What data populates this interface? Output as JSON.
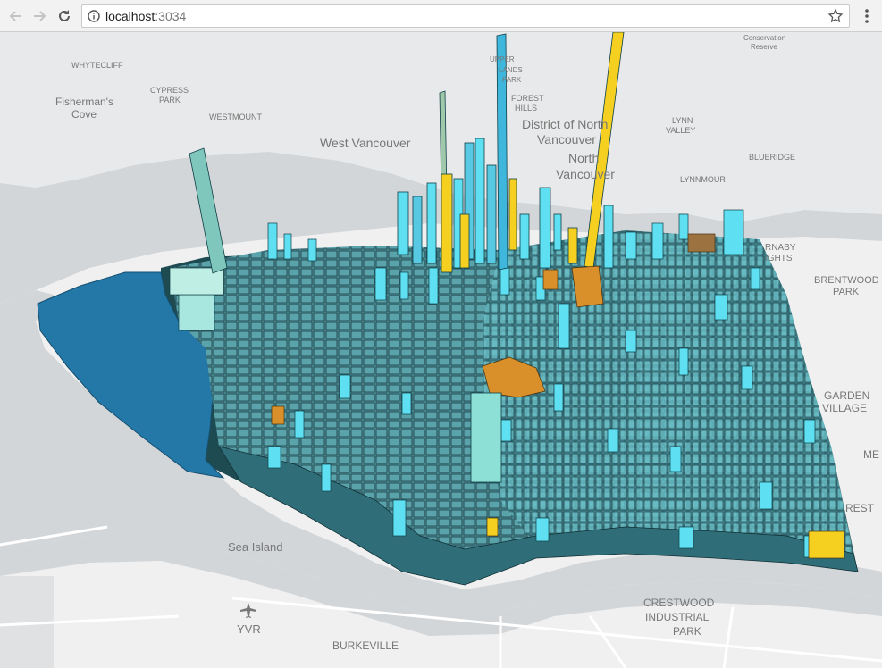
{
  "browser": {
    "url_host": "localhost",
    "url_port": ":3034",
    "icons": [
      "back-arrow-icon",
      "forward-arrow-icon",
      "reload-icon",
      "info-icon",
      "star-icon",
      "kebab-menu-icon"
    ]
  },
  "map": {
    "labels": {
      "whytecliff": "WHYTECLIFF",
      "fisherman1": "Fisherman's",
      "fisherman2": "Cove",
      "cypress1": "CYPRESS",
      "cypress2": "PARK",
      "westmount": "WESTMOUNT",
      "west_vancouver": "West Vancouver",
      "upper_lands1": "UPPER",
      "upper_lands2": "LANDS",
      "upper_lands3": "PARK",
      "forest_hills1": "FOREST",
      "forest_hills2": "HILLS",
      "dnv1": "District of North",
      "dnv2": "Vancouver",
      "north1": "North",
      "north2": "Vancouver",
      "lynn1": "LYNN",
      "lynn2": "VALLEY",
      "blueridge": "BLUERIDGE",
      "lynnmour": "LYNNMOUR",
      "conservation1": "Conservation",
      "conservation2": "Reserve",
      "burnaby1": "RNABY",
      "burnaby2": "IGHTS",
      "brentwood1": "BRENTWOOD",
      "brentwood2": "PARK",
      "garden1": "GARDEN",
      "garden2": "VILLAGE",
      "me": "ME",
      "rest": "REST",
      "sea_island": "Sea Island",
      "yvr": "YVR",
      "crestwood1": "CRESTWOOD",
      "crestwood2": "INDUSTRIAL",
      "crestwood3": "PARK",
      "burkeville": "BURKEVILLE"
    },
    "colors": {
      "water": "#d6d9dc",
      "land": "#f2f2f2",
      "building_teal": "#3f8c95",
      "building_cyan": "#5fe0f2",
      "building_yellow": "#f5d020",
      "building_orange": "#d9902a",
      "park_blue": "#2378a7"
    }
  }
}
